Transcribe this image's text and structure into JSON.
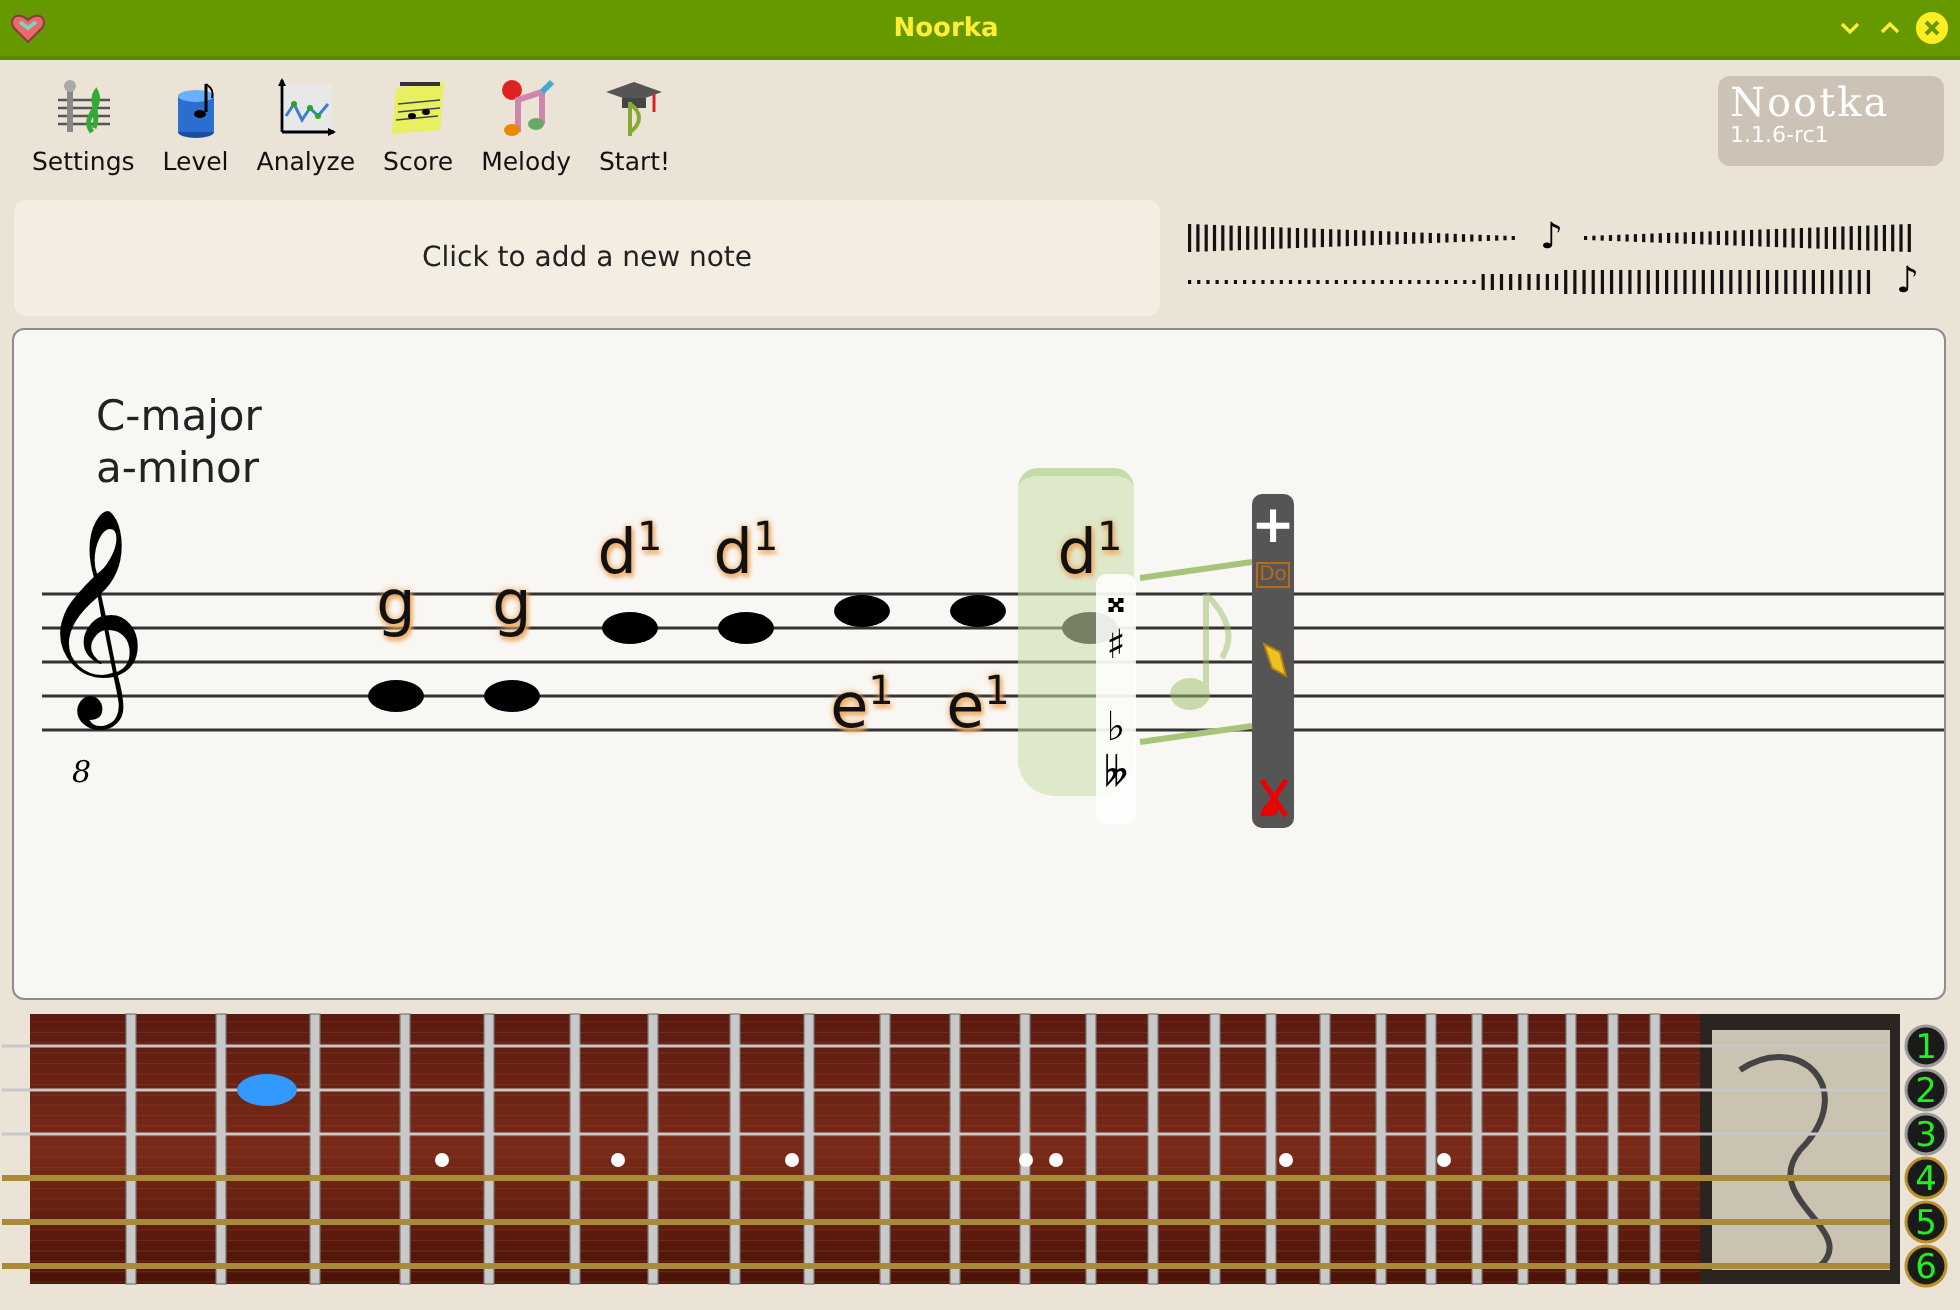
{
  "window": {
    "title": "Noorka"
  },
  "toolbar": {
    "buttons": [
      {
        "label": "Settings",
        "kind": "settings"
      },
      {
        "label": "Level",
        "kind": "level"
      },
      {
        "label": "Analyze",
        "kind": "analyze"
      },
      {
        "label": "Score",
        "kind": "score"
      },
      {
        "label": "Melody",
        "kind": "melody"
      },
      {
        "label": "Start!",
        "kind": "start"
      }
    ],
    "logo": {
      "text": "Nootka",
      "version": "1.1.6-rc1"
    }
  },
  "hint": "Click to add a new note",
  "pitch_meter": {
    "note_symbols": [
      "♪",
      "♪"
    ]
  },
  "score": {
    "key_signature": [
      "C-major",
      "a-minor"
    ],
    "clef": "𝄞",
    "clef_octave": "8",
    "notes": [
      {
        "name": "g",
        "kind": "line4",
        "label_below": false,
        "selected": false
      },
      {
        "name": "g",
        "kind": "line4",
        "label_below": false,
        "selected": false
      },
      {
        "name": "d$^{1}$",
        "kind": "line2",
        "label_below": false,
        "selected": false
      },
      {
        "name": "d$^{1}$",
        "kind": "line2",
        "label_below": false,
        "selected": false
      },
      {
        "name": "e$^{1}$",
        "kind": "space1",
        "label_below": true,
        "selected": false
      },
      {
        "name": "e$^{1}$",
        "kind": "space1",
        "label_below": true,
        "selected": false
      },
      {
        "name": "d$^{1}$",
        "kind": "line2",
        "label_below": false,
        "selected": true
      }
    ],
    "accidentals": [
      "𝄪",
      "♯",
      "♭",
      "𝄫"
    ],
    "note_tools": {
      "add": "+",
      "name_style": "Do"
    }
  },
  "fretboard": {
    "strings": [
      {
        "number": "1",
        "kind": "plain",
        "marked": false
      },
      {
        "number": "2",
        "kind": "plain",
        "marked": true
      },
      {
        "number": "3",
        "kind": "plain",
        "marked": false
      },
      {
        "number": "4",
        "kind": "wound",
        "marked": false
      },
      {
        "number": "5",
        "kind": "wound",
        "marked": false
      },
      {
        "number": "6",
        "kind": "wound",
        "marked": false
      }
    ]
  }
}
